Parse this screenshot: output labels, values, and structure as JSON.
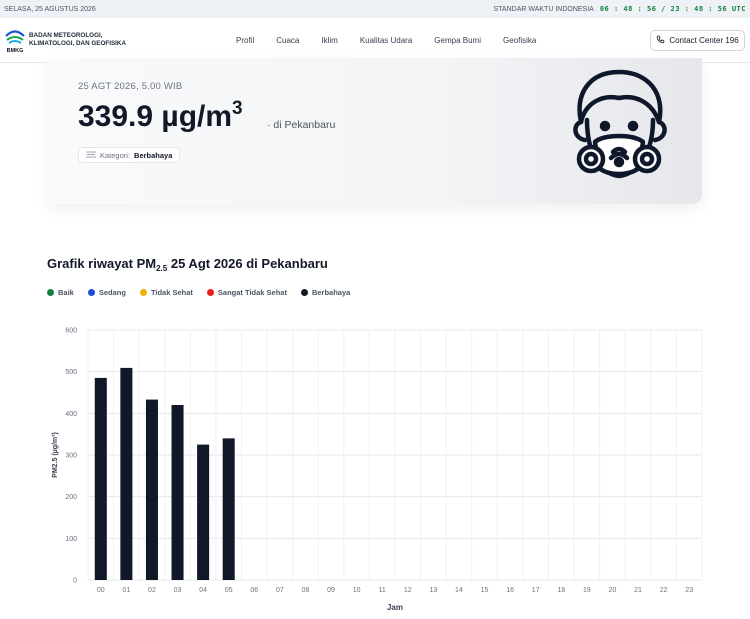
{
  "topbar": {
    "date": "SELASA, 25 AGUSTUS 2026",
    "timezone_label": "STANDAR WAKTU INDONESIA",
    "clock": "06 : 48 : 56  /  23 : 48 : 56 UTC"
  },
  "brand": {
    "name_line1": "BADAN METEOROLOGI,",
    "name_line2": "KLIMATOLOGI, DAN GEOFISIKA",
    "logo_text": "BMKG"
  },
  "nav": {
    "items": [
      "Profil",
      "Cuaca",
      "Iklim",
      "Kualitas Udara",
      "Gempa Bumi",
      "Geofisika"
    ],
    "contact_label": "Contact Center 196"
  },
  "hero": {
    "date": "25 AGT 2026, 5.00 WIB",
    "value": "339.9 µg/m",
    "value_exp": "3",
    "location": "·  di Pekanbaru",
    "category_label": "Kategori:",
    "category_value": "Berbahaya",
    "icon": "gas-mask-face-icon"
  },
  "chart_section": {
    "title_pre": "Grafik riwayat PM",
    "title_sub": "2.5",
    "title_post": " 25 Agt 2026 di Pekanbaru"
  },
  "legend": [
    {
      "label": "Baik",
      "color": "#15803d"
    },
    {
      "label": "Sedang",
      "color": "#1d4ed8"
    },
    {
      "label": "Tidak Sehat",
      "color": "#eab308"
    },
    {
      "label": "Sangat Tidak Sehat",
      "color": "#ef1c1c"
    },
    {
      "label": "Berbahaya",
      "color": "#111827"
    }
  ],
  "chart_data": {
    "type": "bar",
    "categories": [
      "00",
      "01",
      "02",
      "03",
      "04",
      "05",
      "06",
      "07",
      "08",
      "09",
      "10",
      "11",
      "12",
      "13",
      "14",
      "15",
      "16",
      "17",
      "18",
      "19",
      "20",
      "21",
      "22",
      "23"
    ],
    "values": [
      485,
      509,
      433,
      420,
      325,
      339.9,
      null,
      null,
      null,
      null,
      null,
      null,
      null,
      null,
      null,
      null,
      null,
      null,
      null,
      null,
      null,
      null,
      null,
      null
    ],
    "xlabel": "Jam",
    "ylabel": "PM2.5 (µg/m³)",
    "ylim": [
      0,
      600
    ],
    "yticks": [
      0,
      100,
      200,
      300,
      400,
      500,
      600
    ],
    "bar_color": "#111827",
    "grid": true,
    "legend_position": "top-left"
  }
}
